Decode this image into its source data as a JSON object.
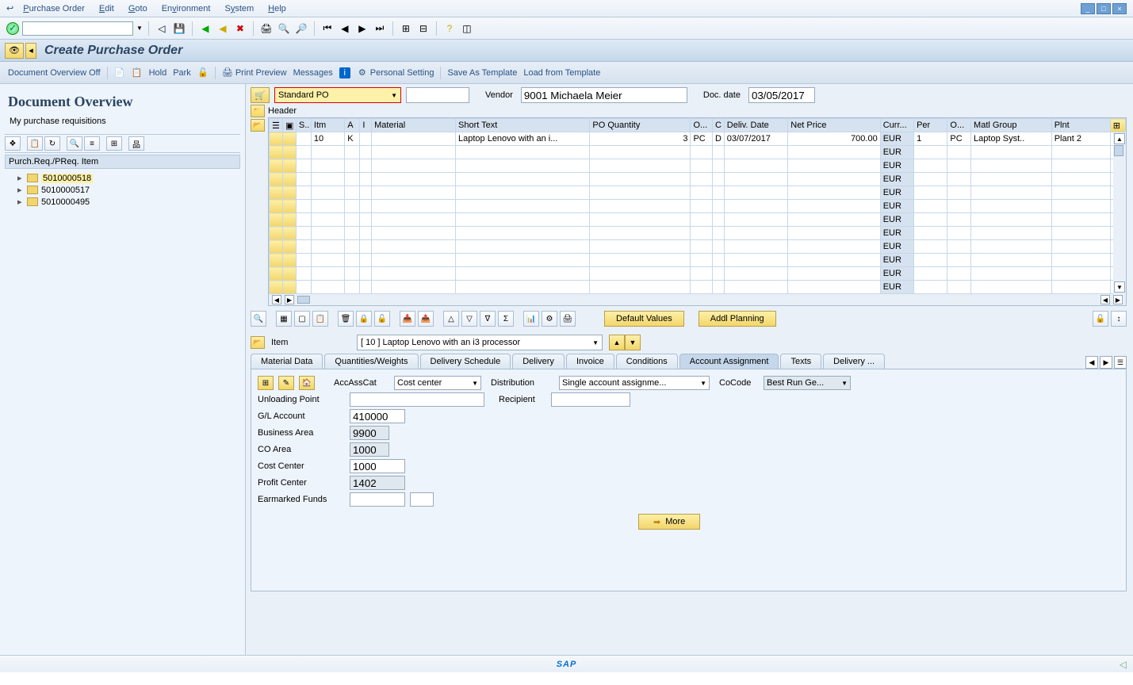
{
  "menu": {
    "items": [
      "Purchase Order",
      "Edit",
      "Goto",
      "Environment",
      "System",
      "Help"
    ]
  },
  "title": "Create Purchase Order",
  "app_toolbar": {
    "doc_overview": "Document Overview Off",
    "hold": "Hold",
    "park": "Park",
    "print_preview": "Print Preview",
    "messages": "Messages",
    "personal_setting": "Personal Setting",
    "save_template": "Save As Template",
    "load_template": "Load from Template"
  },
  "overview": {
    "title": "Document Overview",
    "subtitle": "My purchase requisitions",
    "header": "Purch.Req./PReq. Item",
    "items": [
      "5010000518",
      "5010000517",
      "5010000495"
    ]
  },
  "po": {
    "type": "Standard PO",
    "vendor_label": "Vendor",
    "vendor": "9001 Michaela Meier",
    "docdate_label": "Doc. date",
    "docdate": "03/05/2017",
    "header_label": "Header"
  },
  "cols": {
    "s": "S..",
    "itm": "Itm",
    "a": "A",
    "i": "I",
    "material": "Material",
    "short": "Short Text",
    "qty": "PO Quantity",
    "o": "O...",
    "c": "C",
    "deliv": "Deliv. Date",
    "net": "Net Price",
    "curr": "Curr...",
    "per": "Per",
    "o2": "O...",
    "matgrp": "Matl Group",
    "plnt": "Plnt"
  },
  "row": {
    "itm": "10",
    "a": "K",
    "short": "Laptop Lenovo with an i...",
    "qty": "3",
    "ou": "PC",
    "c": "D",
    "deliv": "03/07/2017",
    "net": "700.00",
    "curr": "EUR",
    "per": "1",
    "o2": "PC",
    "matgrp": "Laptop Syst..",
    "plnt": "Plant 2"
  },
  "eur": "EUR",
  "buttons": {
    "default_values": "Default Values",
    "addl_planning": "Addl Planning"
  },
  "item_detail": {
    "label": "Item",
    "selected": "[ 10 ] Laptop Lenovo with an i3 processor"
  },
  "tabs": [
    "Material Data",
    "Quantities/Weights",
    "Delivery Schedule",
    "Delivery",
    "Invoice",
    "Conditions",
    "Account Assignment",
    "Texts",
    "Delivery ..."
  ],
  "active_tab": 6,
  "aa": {
    "accasscat_label": "AccAssCat",
    "accasscat": "Cost center",
    "distribution_label": "Distribution",
    "distribution": "Single account assignme...",
    "cocode_label": "CoCode",
    "cocode": "Best Run Ge...",
    "unloading_label": "Unloading Point",
    "recipient_label": "Recipient",
    "gl_label": "G/L Account",
    "gl": "410000",
    "ba_label": "Business Area",
    "ba": "9900",
    "co_label": "CO Area",
    "co": "1000",
    "cc_label": "Cost Center",
    "cc": "1000",
    "pc_label": "Profit Center",
    "pc": "1402",
    "ef_label": "Earmarked Funds",
    "more": "More"
  },
  "footer": {
    "logo": "SAP"
  }
}
